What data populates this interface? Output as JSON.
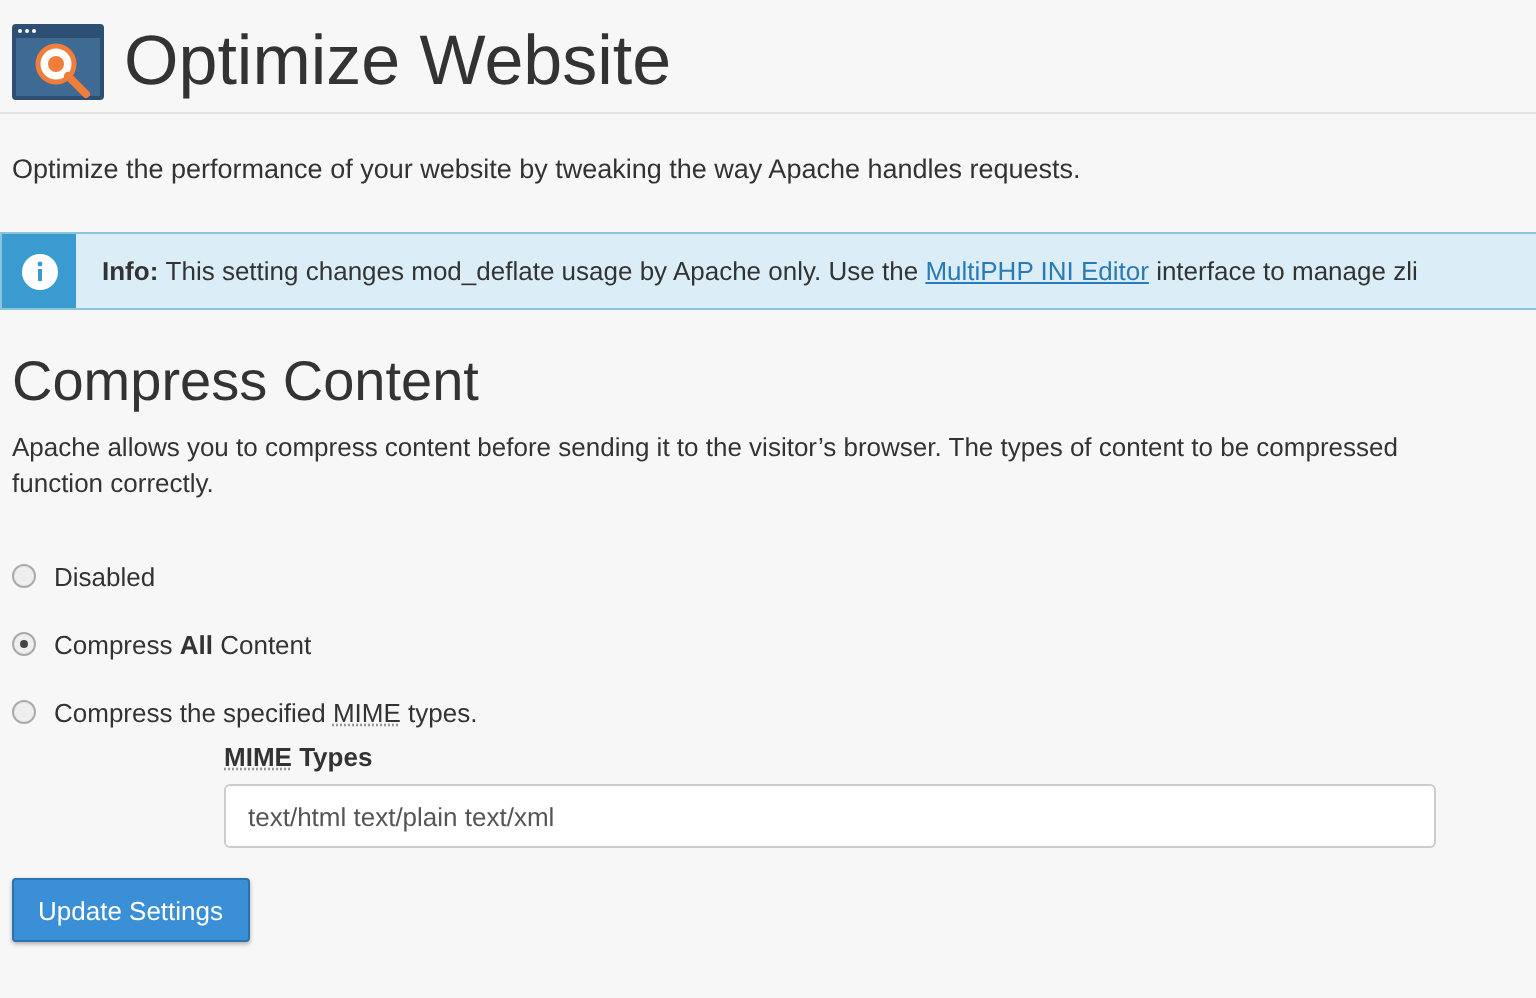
{
  "page": {
    "title": "Optimize Website",
    "description": "Optimize the performance of your website by tweaking the way Apache handles requests."
  },
  "info": {
    "label": "Info:",
    "text_before": "This setting changes mod_deflate usage by Apache only. Use the",
    "link": "MultiPHP INI Editor",
    "text_after": "interface to manage zli"
  },
  "section": {
    "title": "Compress Content",
    "description": "Apache allows you to compress content before sending it to the visitor’s browser. The types of content to be compressed\nfunction correctly."
  },
  "options": [
    {
      "parts": [
        {
          "kind": "text",
          "text": "Disabled"
        }
      ],
      "selected": false
    },
    {
      "parts": [
        {
          "kind": "text",
          "text": "Compress "
        },
        {
          "kind": "bold",
          "text": "All"
        },
        {
          "kind": "text",
          "text": " Content"
        }
      ],
      "selected": true
    },
    {
      "parts": [
        {
          "kind": "text",
          "text": "Compress the specified "
        },
        {
          "kind": "abbr",
          "text": "MIME"
        },
        {
          "kind": "text",
          "text": " types."
        }
      ],
      "selected": false
    }
  ],
  "mime_field": {
    "label_parts": [
      {
        "kind": "abbr",
        "text": "MIME"
      },
      {
        "kind": "text",
        "text": " Types"
      }
    ],
    "value": "text/html text/plain text/xml"
  },
  "buttons": [
    {
      "label": "Update Settings"
    }
  ]
}
